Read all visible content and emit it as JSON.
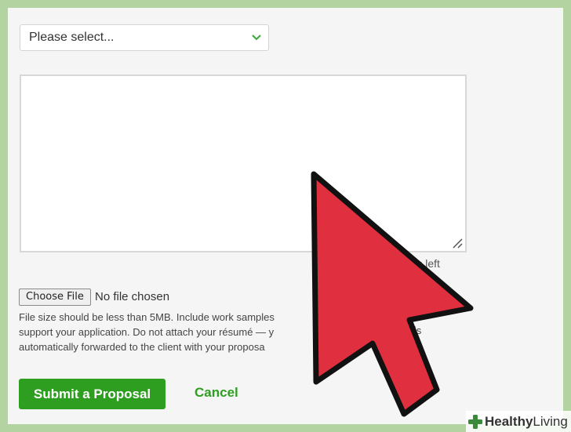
{
  "form": {
    "select_value": "Please select...",
    "chars_left": "cters left",
    "file_button_label": "Choose File",
    "file_status": "No file chosen",
    "help_lines": [
      "File size should be less than 5MB. Include work samples",
      "support your application. Do not attach your résumé — y",
      "automatically forwarded to the client with your proposa"
    ],
    "help_suffix_line2": "e is",
    "submit_label": "Submit a Proposal",
    "cancel_label": "Cancel"
  },
  "watermark": {
    "brand_bold": "Healthy",
    "brand_rest": " Living"
  },
  "colors": {
    "accent": "#2e9e21",
    "cursor_fill": "#e03040",
    "frame": "#b3d3a1"
  },
  "icons": {
    "dropdown": "chevron-down-icon",
    "resize": "resize-handle-icon",
    "cursor": "mouse-pointer-icon",
    "logo": "plus-leaf-icon"
  }
}
